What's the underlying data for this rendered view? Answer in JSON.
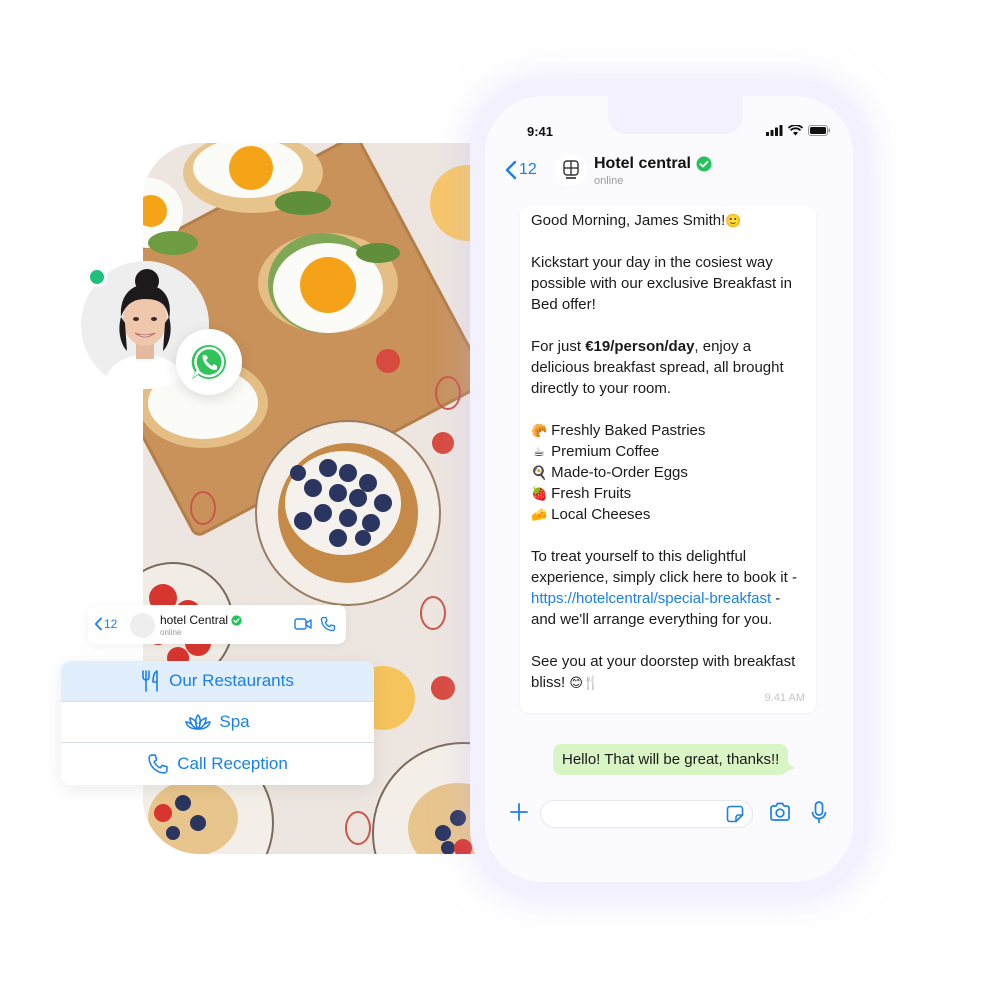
{
  "status_bar": {
    "time": "9:41"
  },
  "chat_header": {
    "back_count": "12",
    "contact_name": "Hotel central",
    "contact_status": "online",
    "verified": true
  },
  "messages": {
    "incoming": {
      "greeting": "Good Morning, James Smith!",
      "greeting_emoji": "🙂",
      "intro": "Kickstart your day in the cosiest way possible with our exclusive Breakfast in Bed offer!",
      "price_prefix": "For just ",
      "price": "€19/person/day",
      "price_suffix": ", enjoy a delicious breakfast spread, all brought directly to your room.",
      "items": [
        {
          "emoji": "🥐",
          "label": "Freshly Baked Pastries"
        },
        {
          "emoji": "☕",
          "label": "Premium Coffee"
        },
        {
          "emoji": "🍳",
          "label": "Made-to-Order Eggs"
        },
        {
          "emoji": "🍓",
          "label": "Fresh Fruits"
        },
        {
          "emoji": "🧀",
          "label": "Local Cheeses"
        }
      ],
      "cta_prefix": "To treat yourself to this delightful experience, simply click here to book it - ",
      "cta_link": "https://hotelcentral/special-breakfast",
      "cta_suffix": " - and we'll arrange everything for you.",
      "closing": "See you at your doorstep with breakfast bliss! ",
      "closing_emoji": "😊🍴",
      "time": "9.41 AM"
    },
    "outgoing": {
      "text": "Hello! That will be great, thanks!!"
    }
  },
  "composer": {
    "placeholder": ""
  },
  "mini_header": {
    "back_count": "12",
    "contact_name": "hotel Central",
    "contact_status": "online"
  },
  "quick_replies": [
    {
      "icon": "fork-knife-icon",
      "label": "Our Restaurants",
      "active": true
    },
    {
      "icon": "lotus-icon",
      "label": "Spa",
      "active": false
    },
    {
      "icon": "phone-icon",
      "label": "Call Reception",
      "active": false
    }
  ],
  "colors": {
    "accent": "#1a80e5",
    "outgoing_bubble": "#d9f5c5",
    "online": "#1fc07a",
    "verified": "#25c15a",
    "active_reply": "#e1effc"
  }
}
